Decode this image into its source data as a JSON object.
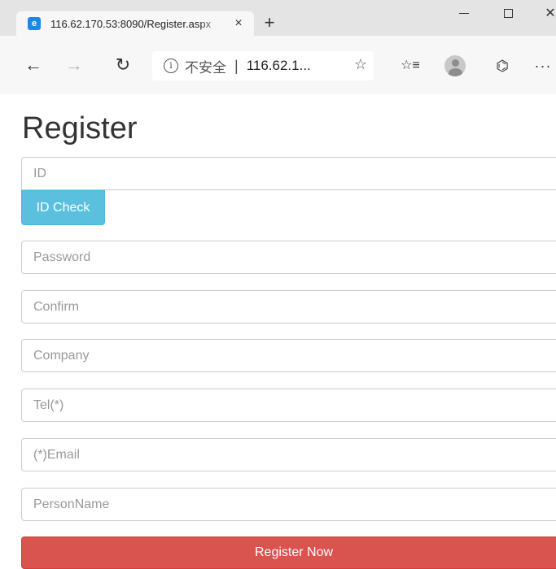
{
  "browser": {
    "tab_title": "116.62.170.53:8090/Register.aspx",
    "tab_close": "×",
    "new_tab": "+",
    "window_close": "✕",
    "address": {
      "security_label": "不安全",
      "separator": "|",
      "url": "116.62.1..."
    },
    "icons": {
      "back": "←",
      "forward": "→",
      "reload": "↻",
      "info": "i",
      "favorite": "☆",
      "favorites_list": "☆≡",
      "share": "⌬",
      "more": "···"
    }
  },
  "page": {
    "title": "Register",
    "fields": {
      "id_placeholder": "ID",
      "password_placeholder": "Password",
      "confirm_placeholder": "Confirm",
      "company_placeholder": "Company",
      "tel_placeholder": "Tel(*)",
      "email_placeholder": "(*)Email",
      "person_name_placeholder": "PersonName"
    },
    "id_check_label": "ID Check",
    "register_label": "Register Now"
  },
  "colors": {
    "id_check_button": "#5bc0de",
    "register_button": "#d9534f"
  }
}
